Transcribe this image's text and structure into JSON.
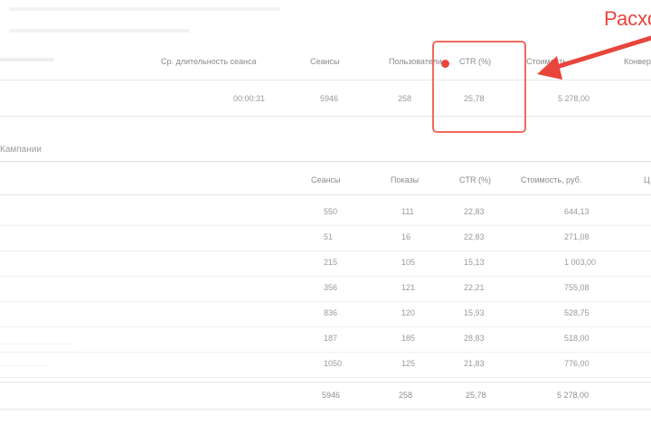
{
  "summary": {
    "headers": {
      "col1": "Ср. длительность сеанса",
      "col2": "Сеансы",
      "col3": "Пользователи",
      "col4": "CTR (%)",
      "col5": "Стоимость",
      "col6": "Конверсии"
    },
    "row": {
      "col1": "00:00:31",
      "col2": "5946",
      "col3": "258",
      "col4": "25,78",
      "col5": "5 278,00"
    }
  },
  "section": {
    "title": "Кампании"
  },
  "detail": {
    "headers": {
      "col1": "Сеансы",
      "col2": "Показы",
      "col3": "CTR (%)",
      "col4": "Стоимость, руб.",
      "col5": "Ц"
    },
    "rows": [
      {
        "c1": "550",
        "c2": "111",
        "c3": "22,83",
        "c4": "644,13"
      },
      {
        "c1": "51",
        "c2": "16",
        "c3": "22,83",
        "c4": "271,08"
      },
      {
        "c1": "215",
        "c2": "105",
        "c3": "15,13",
        "c4": "1 003,00"
      },
      {
        "c1": "356",
        "c2": "121",
        "c3": "22,21",
        "c4": "755,08"
      },
      {
        "c1": "836",
        "c2": "120",
        "c3": "15,93",
        "c4": "528,75"
      },
      {
        "c1": "187",
        "c2": "185",
        "c3": "28,83",
        "c4": "518,00"
      },
      {
        "c1": "1050",
        "c2": "125",
        "c3": "21,83",
        "c4": "776,00"
      }
    ],
    "total": {
      "c1": "5946",
      "c2": "258",
      "c3": "25,78",
      "c4": "5 278,00"
    }
  },
  "annotation": {
    "label": "Расхо",
    "color": "#e8453c"
  }
}
